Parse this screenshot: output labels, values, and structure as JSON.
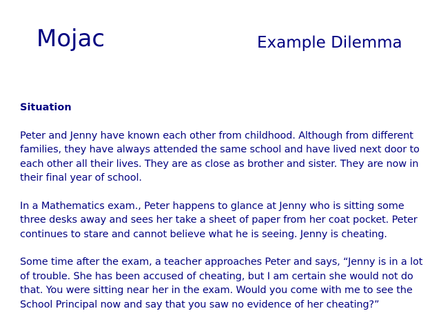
{
  "header": {
    "app_title": "Mojac",
    "subtitle": "Example Dilemma"
  },
  "content": {
    "heading": "Situation",
    "paragraphs": [
      "Peter and Jenny have known each other from childhood. Although from different families, they have always attended the same school and have lived next door to each other all their lives. They are as close as brother and sister. They are now in their final year of school.",
      "In a Mathematics exam., Peter happens to glance at Jenny who is sitting some three desks away and sees her take a sheet of paper from her coat pocket. Peter continues to stare and cannot believe what he is seeing. Jenny is cheating.",
      "Some time after the exam, a teacher approaches Peter and says, “Jenny is in a lot of trouble. She has been accused of cheating, but I am certain she would not do that. You were sitting near her in the exam. Would you come with me to see the School Principal now and say that you saw no evidence of her cheating?”"
    ]
  },
  "colors": {
    "text": "#000080",
    "background": "#ffffff"
  }
}
